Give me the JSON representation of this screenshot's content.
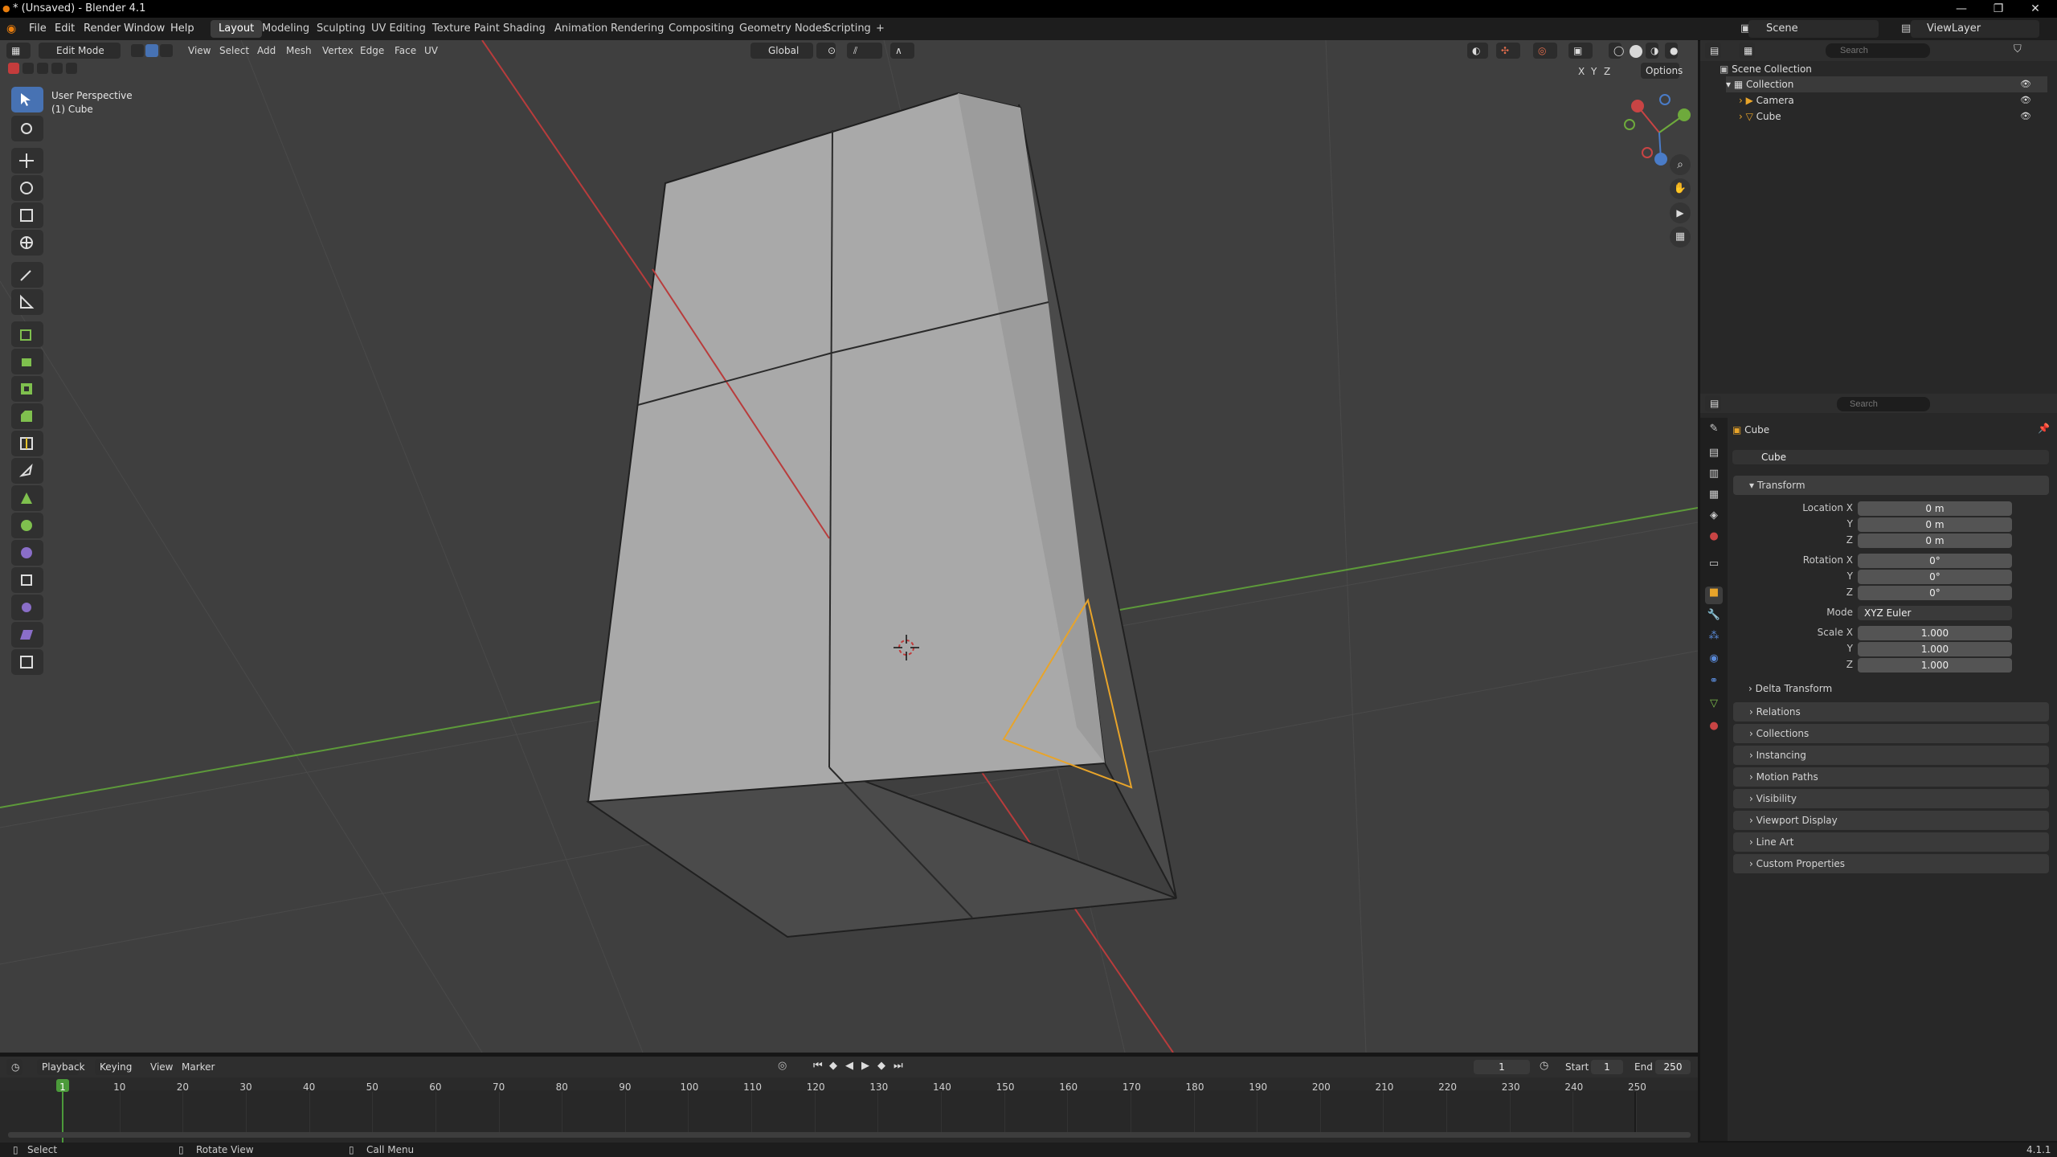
{
  "window": {
    "title": "* (Unsaved) - Blender 4.1",
    "minimize": "—",
    "maximize": "❐",
    "close": "✕"
  },
  "menus": [
    "File",
    "Edit",
    "Render",
    "Window",
    "Help"
  ],
  "workspaces": [
    "Layout",
    "Modeling",
    "Sculpting",
    "UV Editing",
    "Texture Paint",
    "Shading",
    "Animation",
    "Rendering",
    "Compositing",
    "Geometry Nodes",
    "Scripting"
  ],
  "active_workspace": "Layout",
  "add_workspace": "+",
  "scene": {
    "name": "Scene",
    "view_layer": "ViewLayer"
  },
  "viewport_header": {
    "mode": "Edit Mode",
    "menus": [
      "View",
      "Select",
      "Add",
      "Mesh",
      "Vertex",
      "Edge",
      "Face",
      "UV"
    ],
    "orientation": "Global",
    "options": "Options",
    "axes": [
      "X",
      "Y",
      "Z"
    ]
  },
  "viewport_overlay": {
    "perspective": "User Perspective",
    "object": "(1) Cube"
  },
  "outliner": {
    "search_placeholder": "Search",
    "scene_collection": "Scene Collection",
    "collection": "Collection",
    "items": [
      "Camera",
      "Cube"
    ]
  },
  "properties": {
    "search_placeholder": "Search",
    "object_name": "Cube",
    "data_name": "Cube",
    "transform_label": "Transform",
    "location": {
      "label": "Location X",
      "x": "0 m",
      "y": "0 m",
      "z": "0 m"
    },
    "rotation": {
      "label": "Rotation X",
      "x": "0°",
      "y": "0°",
      "z": "0°"
    },
    "mode": {
      "label": "Mode",
      "value": "XYZ Euler"
    },
    "scale": {
      "label": "Scale X",
      "x": "1.000",
      "y": "1.000",
      "z": "1.000"
    },
    "axis_y": "Y",
    "axis_z": "Z",
    "delta_transform": "Delta Transform",
    "panels": [
      "Relations",
      "Collections",
      "Instancing",
      "Motion Paths",
      "Visibility",
      "Viewport Display",
      "Line Art",
      "Custom Properties"
    ]
  },
  "timeline": {
    "menus": [
      "Playback",
      "Keying",
      "View",
      "Marker"
    ],
    "current_frame": "1",
    "start_label": "Start",
    "start": "1",
    "end_label": "End",
    "end": "250",
    "ticks": [
      "1",
      "10",
      "20",
      "30",
      "40",
      "50",
      "60",
      "70",
      "80",
      "90",
      "100",
      "110",
      "120",
      "130",
      "140",
      "150",
      "160",
      "170",
      "180",
      "190",
      "200",
      "210",
      "220",
      "230",
      "240",
      "250"
    ]
  },
  "statusbar": {
    "select": "Select",
    "rotate": "Rotate View",
    "menu": "Call Menu",
    "version": "4.1.1"
  },
  "colors": {
    "accent": "#4772b3",
    "selection": "#e8a42a",
    "x_axis": "#b83c3c",
    "y_axis": "#5d9a3a"
  }
}
